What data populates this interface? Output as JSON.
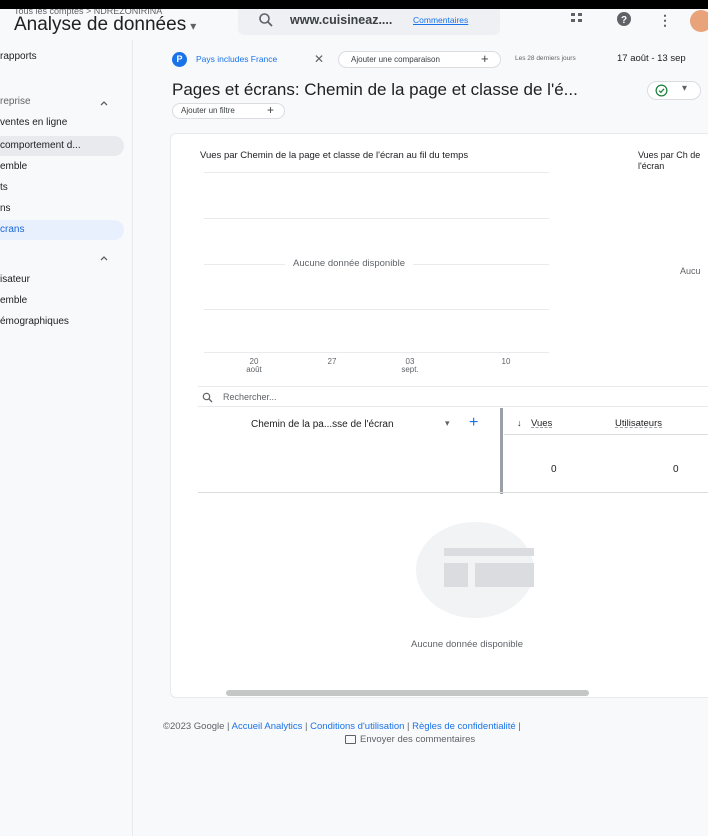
{
  "header": {
    "breadcrumb": "Tous les comptes > NDREZONIRINA",
    "app_title": "Analyse de données",
    "search_site": "www.cuisineaz....",
    "search_link": "Commentaires"
  },
  "sidebar": {
    "items": [
      {
        "label": "rapports"
      },
      {
        "label": "reprise"
      },
      {
        "label": "ventes en ligne"
      },
      {
        "label": "comportement d..."
      },
      {
        "label": "emble"
      },
      {
        "label": "ts"
      },
      {
        "label": "ns"
      },
      {
        "label": "crans"
      },
      {
        "label": "isateur"
      },
      {
        "label": "emble"
      },
      {
        "label": "émographiques"
      }
    ]
  },
  "filters": {
    "chip_letter": "P",
    "chip_text": "Pays includes France",
    "compare_label": "Ajouter une comparaison",
    "date_label": "Les 28 derniers jours",
    "date_range": "17 août - 13 sep"
  },
  "page": {
    "title": "Pages et écrans: Chemin de la page et classe de l'é...",
    "add_filter": "Ajouter un filtre"
  },
  "chart": {
    "title": "Vues par Chemin de la page et classe de l'écran au fil du temps",
    "no_data": "Aucune donnée disponible",
    "side_title": "Vues par Ch de l'écran",
    "side_no_data": "Aucu",
    "x_ticks": [
      {
        "day": "20",
        "month": "août"
      },
      {
        "day": "27",
        "month": ""
      },
      {
        "day": "03",
        "month": "sept."
      },
      {
        "day": "10",
        "month": ""
      }
    ]
  },
  "table": {
    "search_placeholder": "Rechercher...",
    "dimension_header": "Chemin de la pa...sse de l'écran",
    "col_views": "Vues",
    "col_users": "Utilisateurs",
    "views_total": "0",
    "users_total": "0",
    "no_data": "Aucune donnée disponible"
  },
  "footer": {
    "copyright": "©2023 Google | ",
    "link1": "Accueil Analytics",
    "sep1": " | ",
    "link2": "Conditions d'utilisation",
    "sep2": " | ",
    "link3": "Règles de confidentialité",
    "sep3": " |",
    "feedback": "Envoyer des commentaires"
  },
  "colors": {
    "accent": "#1a73e8",
    "active_bg": "#e8f0fe"
  }
}
